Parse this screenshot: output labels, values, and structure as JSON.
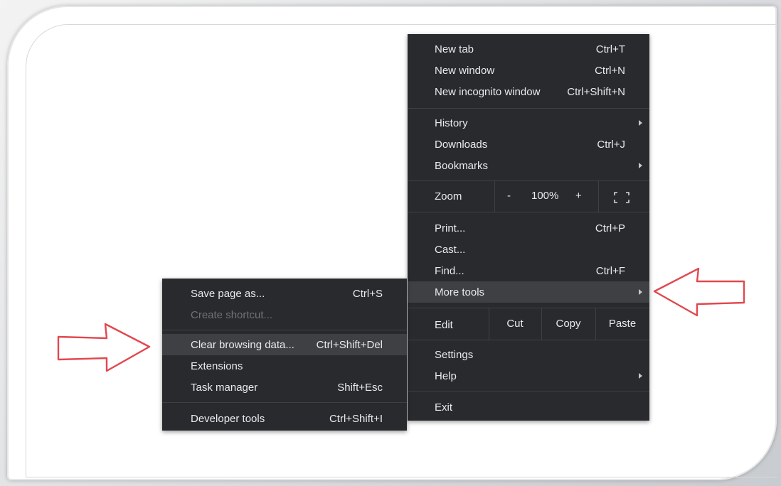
{
  "main_menu": {
    "new_tab": {
      "label": "New tab",
      "shortcut": "Ctrl+T"
    },
    "new_window": {
      "label": "New window",
      "shortcut": "Ctrl+N"
    },
    "new_incognito": {
      "label": "New incognito window",
      "shortcut": "Ctrl+Shift+N"
    },
    "history": {
      "label": "History"
    },
    "downloads": {
      "label": "Downloads",
      "shortcut": "Ctrl+J"
    },
    "bookmarks": {
      "label": "Bookmarks"
    },
    "zoom": {
      "label": "Zoom",
      "minus": "-",
      "value": "100%",
      "plus": "+"
    },
    "print": {
      "label": "Print...",
      "shortcut": "Ctrl+P"
    },
    "cast": {
      "label": "Cast..."
    },
    "find": {
      "label": "Find...",
      "shortcut": "Ctrl+F"
    },
    "more_tools": {
      "label": "More tools"
    },
    "edit": {
      "label": "Edit",
      "cut": "Cut",
      "copy": "Copy",
      "paste": "Paste"
    },
    "settings": {
      "label": "Settings"
    },
    "help": {
      "label": "Help"
    },
    "exit": {
      "label": "Exit"
    }
  },
  "sub_menu": {
    "save_page": {
      "label": "Save page as...",
      "shortcut": "Ctrl+S"
    },
    "create_shortcut": {
      "label": "Create shortcut..."
    },
    "clear_browsing": {
      "label": "Clear browsing data...",
      "shortcut": "Ctrl+Shift+Del"
    },
    "extensions": {
      "label": "Extensions"
    },
    "task_manager": {
      "label": "Task manager",
      "shortcut": "Shift+Esc"
    },
    "developer_tools": {
      "label": "Developer tools",
      "shortcut": "Ctrl+Shift+I"
    }
  },
  "colors": {
    "menu_bg": "#292a2d",
    "highlight": "#3f4043",
    "annotation_arrow": "#e2474f"
  },
  "annotations": [
    "arrow-icon",
    "arrow-icon"
  ]
}
